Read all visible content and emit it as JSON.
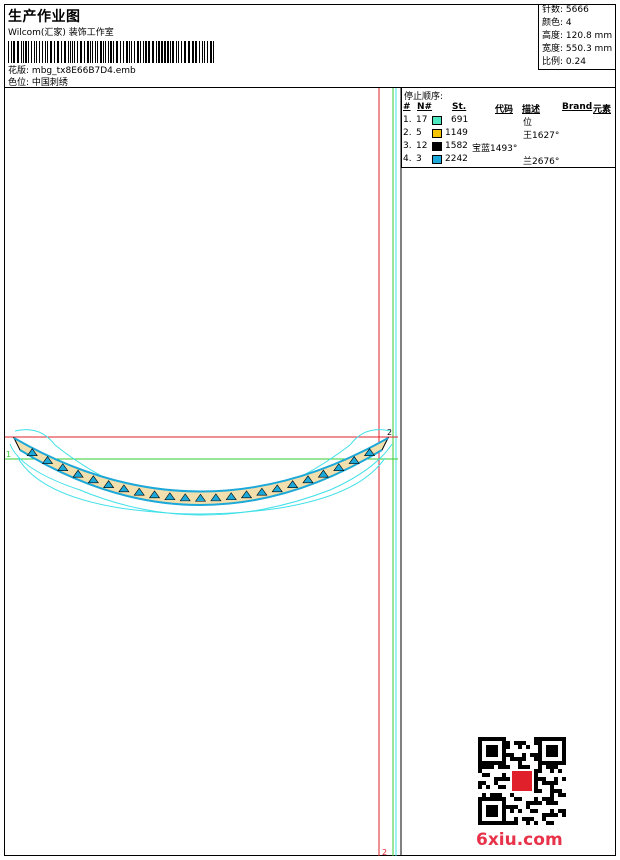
{
  "header": {
    "title": "生产作业图",
    "company": "Wilcom(汇家) 装饰工作室",
    "design_label": "花版:",
    "design_value": "mbg_tx8E66B7D4.emb",
    "color_label": "色位:",
    "color_value": "中国刺绣"
  },
  "stats": [
    {
      "label": "针数:",
      "value": "5666"
    },
    {
      "label": "颜色:",
      "value": "4"
    },
    {
      "label": "高度:",
      "value": "120.8 mm"
    },
    {
      "label": "宽度:",
      "value": "550.3 mm"
    },
    {
      "label": "比例:",
      "value": "0.24"
    }
  ],
  "stop_sequence": {
    "title": "停止顺序:",
    "headers": {
      "num": "#",
      "n": "N#",
      "st": "St.",
      "code": "代码",
      "desc": "描述",
      "brand": "Brand",
      "element": "元素"
    },
    "rows": [
      {
        "num": "1.",
        "n": "17",
        "color": "#4de8c0",
        "st": "691",
        "code": "",
        "desc": "位"
      },
      {
        "num": "2.",
        "n": "5",
        "color": "#f5c400",
        "st": "1149",
        "code": "",
        "desc": "王1627°"
      },
      {
        "num": "3.",
        "n": "12",
        "color": "#000000",
        "st": "1582",
        "code": "宝蓝1493°",
        "desc": ""
      },
      {
        "num": "4.",
        "n": "3",
        "color": "#1ca8d8",
        "st": "2242",
        "code": "",
        "desc": "兰2676°"
      }
    ]
  },
  "markers": {
    "one": "1",
    "two": "2"
  },
  "watermark": {
    "site": "6xiu.com"
  },
  "colors": {
    "red_guide": "#e0202a",
    "green_guide": "#33cc33",
    "cyan_outline": "#40e0e8"
  }
}
